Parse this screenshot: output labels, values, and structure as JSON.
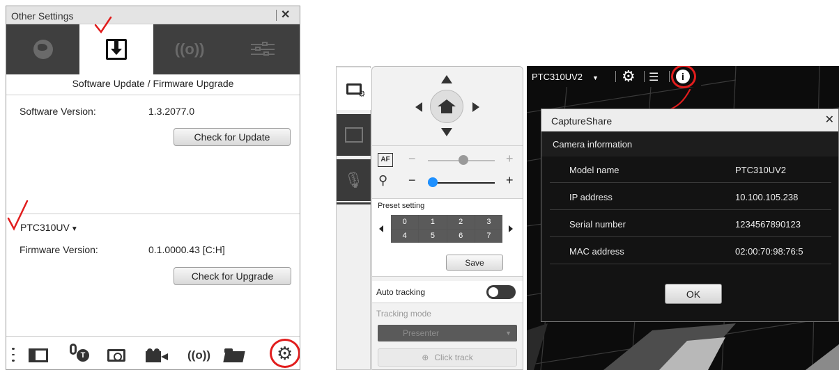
{
  "other_settings": {
    "title": "Other Settings",
    "close_glyph": "✕",
    "tabs": [
      {
        "name": "globe-icon",
        "active": false
      },
      {
        "name": "download-icon",
        "active": true
      },
      {
        "name": "broadcast-icon",
        "active": false
      },
      {
        "name": "sliders-icon",
        "active": false
      }
    ],
    "software_section_title": "Software Update / Firmware Upgrade",
    "software_version_label": "Software Version:",
    "software_version_value": "1.3.2077.0",
    "check_update_label": "Check for Update",
    "model_selected": "PTC310UV",
    "firmware_version_label": "Firmware Version:",
    "firmware_version_value": "0.1.0000.43 [C:H]",
    "check_upgrade_label": "Check for Upgrade",
    "bottom_icons": [
      "more-icon",
      "screen-share-icon",
      "mic-tracking-icon",
      "camera-icon",
      "video-camera-icon",
      "broadcast-icon",
      "folder-icon",
      "gear-icon"
    ],
    "broadcast_glyph": "((o))",
    "gear_glyph": "⚙"
  },
  "controls": {
    "sidebar_icons": [
      "camera-settings-icon",
      "screen-icon",
      "mic-tracking-icon"
    ],
    "af_label": "AF",
    "preset_title": "Preset setting",
    "presets": [
      "0",
      "1",
      "2",
      "3",
      "4",
      "5",
      "6",
      "7"
    ],
    "save_label": "Save",
    "zoom_minus": "−",
    "zoom_plus": "+",
    "auto_tracking_label": "Auto tracking",
    "auto_tracking_on": false,
    "tracking_mode_label": "Tracking mode",
    "tracking_mode_value": "Presenter",
    "click_track_label": "Click track"
  },
  "viewer": {
    "camera_selected": "PTC310UV2",
    "gear_glyph": "⚙",
    "list_glyph": "☰",
    "info_glyph": "i"
  },
  "dialog": {
    "title": "CaptureShare",
    "close_glyph": "✕",
    "section_title": "Camera information",
    "rows": [
      {
        "label": "Model name",
        "value": "PTC310UV2"
      },
      {
        "label": "IP address",
        "value": "10.100.105.238"
      },
      {
        "label": "Serial number",
        "value": "1234567890123"
      },
      {
        "label": "MAC address",
        "value": "02:00:70:98:76:5"
      }
    ],
    "ok_label": "OK"
  },
  "colors": {
    "annotation_red": "#e11d1d",
    "tab_bar": "#3f3f3f",
    "dialog_bg": "#131313",
    "zoom_blue": "#1e90ff"
  }
}
